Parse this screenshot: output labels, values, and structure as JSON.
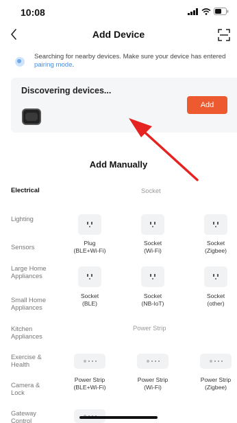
{
  "status_bar": {
    "time": "10:08"
  },
  "nav": {
    "title": "Add Device"
  },
  "search": {
    "message": "Searching for nearby devices. Make sure your device has entered ",
    "link": "pairing mode",
    "suffix": "."
  },
  "discovery": {
    "title": "Discovering devices...",
    "add_label": "Add"
  },
  "manual": {
    "title": "Add Manually"
  },
  "categories": [
    "Electrical",
    "Lighting",
    "Sensors",
    "Large Home Appliances",
    "Small Home Appliances",
    "Kitchen Appliances",
    "Exercise & Health",
    "Camera & Lock",
    "Gateway Control"
  ],
  "sections": {
    "socket": "Socket",
    "power_strip": "Power Strip"
  },
  "devices": {
    "plug_ble_wifi": {
      "name": "Plug",
      "sub": "(BLE+Wi-Fi)",
      "icon": "socket-icon"
    },
    "socket_wifi": {
      "name": "Socket",
      "sub": "(Wi-Fi)",
      "icon": "socket-icon"
    },
    "socket_zigbee": {
      "name": "Socket",
      "sub": "(Zigbee)",
      "icon": "socket-icon"
    },
    "socket_ble": {
      "name": "Socket",
      "sub": "(BLE)",
      "icon": "socket-icon"
    },
    "socket_nbiot": {
      "name": "Socket",
      "sub": "(NB-IoT)",
      "icon": "socket-icon"
    },
    "socket_other": {
      "name": "Socket",
      "sub": "(other)",
      "icon": "socket-icon"
    },
    "strip_ble_wifi": {
      "name": "Power Strip",
      "sub": "(BLE+Wi-Fi)",
      "icon": "power-strip-icon"
    },
    "strip_wifi": {
      "name": "Power Strip",
      "sub": "(Wi-Fi)",
      "icon": "power-strip-icon"
    },
    "strip_zigbee": {
      "name": "Power Strip",
      "sub": "(Zigbee)",
      "icon": "power-strip-icon"
    }
  },
  "colors": {
    "accent": "#ee5a2f",
    "link": "#3f8ef0",
    "annotation_arrow": "#e52421"
  }
}
